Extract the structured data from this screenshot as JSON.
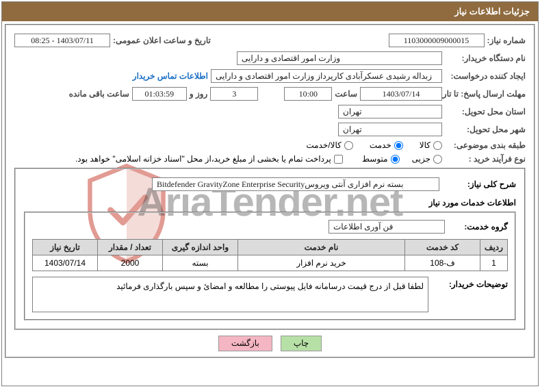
{
  "header": {
    "title": "جزئیات اطلاعات نیاز"
  },
  "needNumber": {
    "label": "شماره نیاز:",
    "value": "1103000009000015"
  },
  "announceDate": {
    "label": "تاریخ و ساعت اعلان عمومی:",
    "value": "1403/07/11 - 08:25"
  },
  "buyerOrg": {
    "label": "نام دستگاه خریدار:",
    "value": "وزارت امور اقتصادی و دارایی"
  },
  "requester": {
    "label": "ایجاد کننده درخواست:",
    "value": "زبداله رشیدی عسکرآبادی کارپرداز وزارت امور اقتصادی و دارایی"
  },
  "contactLink": "اطلاعات تماس خریدار",
  "deadline": {
    "label": "مهلت ارسال پاسخ: تا تاریخ:",
    "date": "1403/07/14",
    "timeLabel": "ساعت",
    "time": "10:00",
    "days": "3",
    "daysLabel": "روز و",
    "remaining": "01:03:59",
    "remainingLabel": "ساعت باقی مانده"
  },
  "province": {
    "label": "استان محل تحویل:",
    "value": "تهران"
  },
  "city": {
    "label": "شهر محل تحویل:",
    "value": "تهران"
  },
  "subjectCat": {
    "label": "طبقه بندی موضوعی:",
    "options": {
      "kala": "کالا",
      "khedmat": "خدمت",
      "kalaKhedmat": "کالا/خدمت"
    }
  },
  "purchaseType": {
    "label": "نوع فرآیند خرید :",
    "options": {
      "jozee": "جزیی",
      "motavaset": "متوسط"
    },
    "note": "پرداخت تمام یا بخشی از مبلغ خرید،از محل \"اسناد خزانه اسلامی\" خواهد بود."
  },
  "generalDesc": {
    "label": "شرح کلی نیاز:",
    "value": "بسته نرم افزاری آنتی ویروسBitdefender GravityZone Enterprise Security"
  },
  "servicesHeader": "اطلاعات خدمات مورد نیاز",
  "serviceGroup": {
    "label": "گروه خدمت:",
    "value": "فن آوری اطلاعات"
  },
  "table": {
    "headers": {
      "row": "ردیف",
      "code": "کد خدمت",
      "name": "نام خدمت",
      "unit": "واحد اندازه گیری",
      "qty": "تعداد / مقدار",
      "date": "تاریخ نیاز"
    },
    "rows": [
      {
        "row": "1",
        "code": "ف-108",
        "name": "خرید نرم افزار",
        "unit": "بسته",
        "qty": "2000",
        "date": "1403/07/14"
      }
    ]
  },
  "buyerNotes": {
    "label": "توضیحات خریدار:",
    "value": "لطفا قبل از درج قیمت درسامانه فایل پیوستی را مطالعه و امضائ و سپس بارگذاری فرمائید"
  },
  "buttons": {
    "print": "چاپ",
    "back": "بازگشت"
  }
}
